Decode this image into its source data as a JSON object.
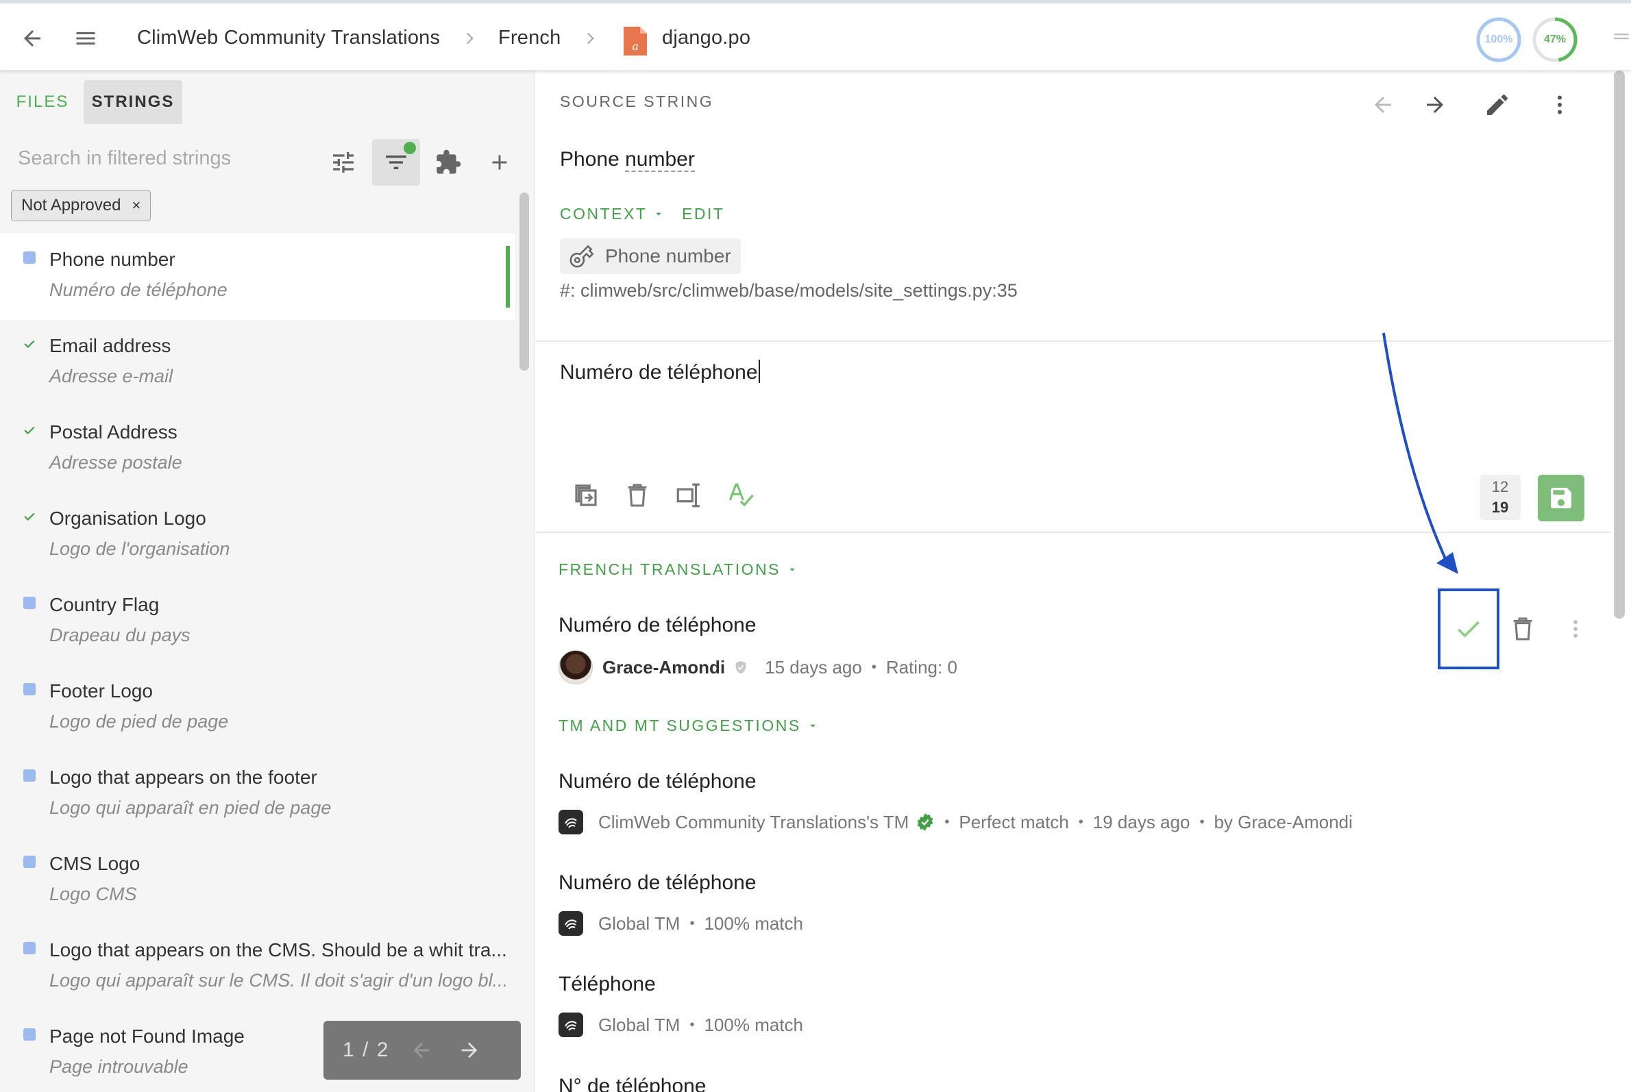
{
  "colors": {
    "accent": "#43a047",
    "annotation": "#1f4fc4",
    "save": "#7fbe7a",
    "untranslated_marker": "#9bbbf0"
  },
  "header": {
    "breadcrumb": [
      "ClimWeb Community Translations",
      "French",
      "django.po"
    ],
    "progress_translated": "100%",
    "progress_approved": "47%",
    "progress_translated_value": 100,
    "progress_approved_value": 47
  },
  "left": {
    "tabs": [
      "FILES",
      "STRINGS"
    ],
    "search_placeholder": "Search in filtered strings",
    "filter_chip": "Not Approved",
    "filter_chip_close": "×",
    "strings": [
      {
        "source": "Phone number",
        "translation": "Numéro de téléphone",
        "state": "untranslated"
      },
      {
        "source": "Email address",
        "translation": "Adresse e-mail",
        "state": "approved"
      },
      {
        "source": "Postal Address",
        "translation": "Adresse postale",
        "state": "approved"
      },
      {
        "source": "Organisation Logo",
        "translation": "Logo de l'organisation",
        "state": "approved"
      },
      {
        "source": "Country Flag",
        "translation": "Drapeau du pays",
        "state": "untranslated"
      },
      {
        "source": "Footer Logo",
        "translation": "Logo de pied de page",
        "state": "untranslated"
      },
      {
        "source": "Logo that appears on the footer",
        "translation": "Logo qui apparaît en pied de page",
        "state": "untranslated"
      },
      {
        "source": "CMS Logo",
        "translation": "Logo CMS",
        "state": "untranslated"
      },
      {
        "source": "Logo that appears on the CMS. Should be a whit tra...",
        "translation": "Logo qui apparaît sur le CMS. Il doit s'agir d'un logo bl...",
        "state": "untranslated"
      },
      {
        "source": "Page not Found Image",
        "translation": "Page introuvable",
        "state": "untranslated"
      }
    ],
    "pager": "1 / 2"
  },
  "source": {
    "section_label": "SOURCE STRING",
    "text_a": "Phone ",
    "text_b": "number",
    "context_label": "CONTEXT",
    "edit_label": "EDIT",
    "key": "Phone number",
    "reference": "#: climweb/src/climweb/base/models/site_settings.py:35"
  },
  "editor": {
    "value": "Numéro de téléphone",
    "char_count_source": "12",
    "char_count_target": "19"
  },
  "translations": {
    "section_label": "FRENCH TRANSLATIONS",
    "items": [
      {
        "text": "Numéro de téléphone",
        "author": "Grace-Amondi",
        "time": "15 days ago",
        "rating": "Rating: 0"
      }
    ]
  },
  "suggestions": {
    "section_label": "TM AND MT SUGGESTIONS",
    "items": [
      {
        "text": "Numéro de téléphone",
        "source": "ClimWeb Community Translations's TM",
        "match": "Perfect match",
        "time": "19 days ago",
        "by": "by Grace-Amondi"
      },
      {
        "text": "Numéro de téléphone",
        "source": "Global TM",
        "match": "100% match"
      },
      {
        "text": "Téléphone",
        "source": "Global TM",
        "match": "100% match"
      },
      {
        "text": "N° de téléphone"
      }
    ]
  }
}
